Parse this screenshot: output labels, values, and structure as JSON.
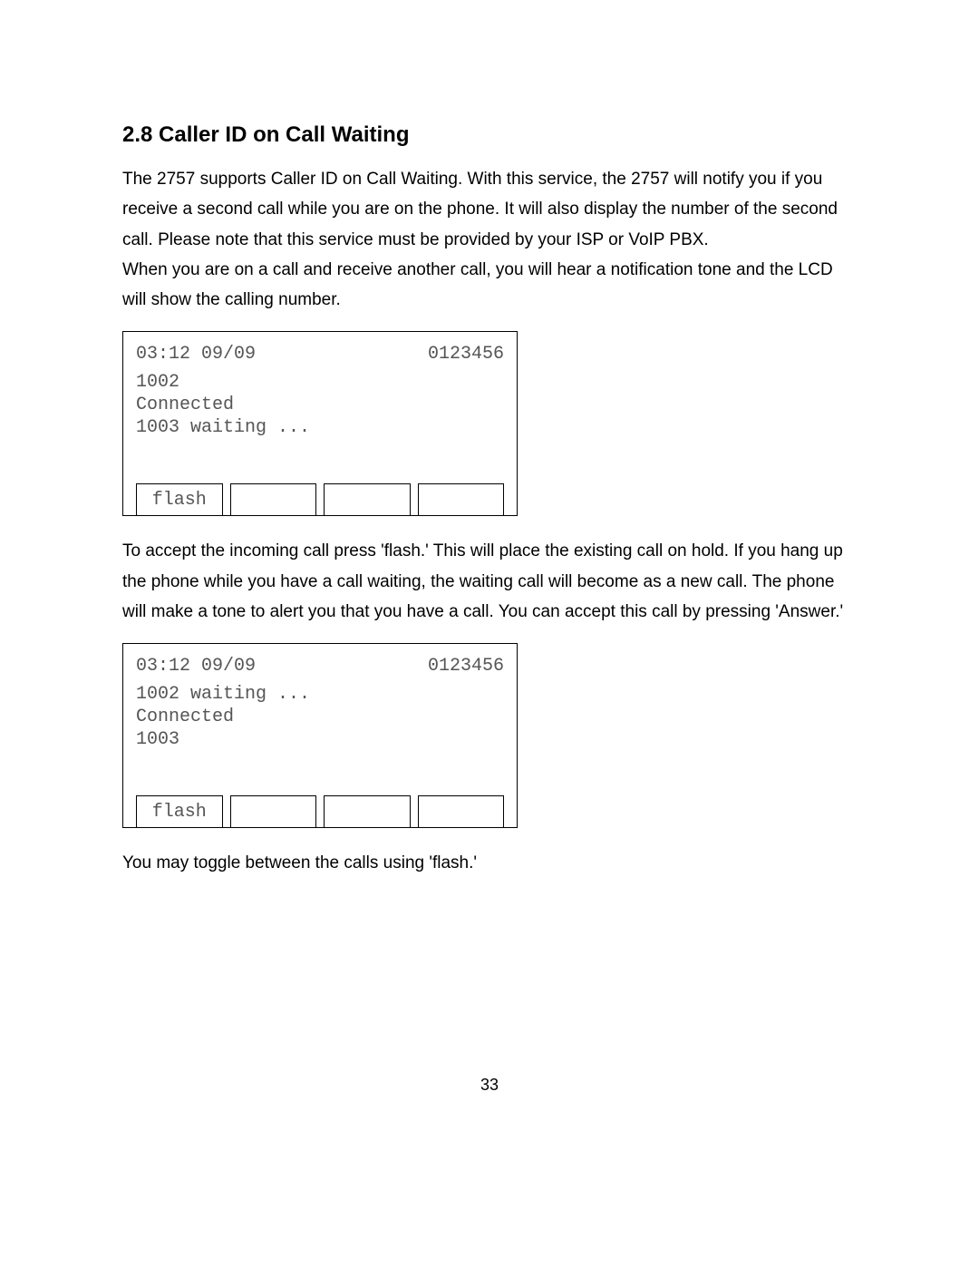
{
  "heading": "2.8 Caller ID on Call Waiting",
  "para1": "The 2757 supports Caller ID on Call Waiting.   With this service, the 2757 will notify you if you receive a second call while you are on the phone.   It will also display the number of the second call.   Please note that this service must be provided by your ISP or VoIP PBX.",
  "para2": "When you are on a call and receive another call, you will hear a notification tone and the LCD will show the calling number.",
  "lcd1": {
    "time_date": "03:12 09/09",
    "right": "0123456",
    "line1": "1002",
    "line2": "Connected",
    "line3": "1003 waiting ...",
    "sk1": "flash",
    "sk2": "",
    "sk3": "",
    "sk4": ""
  },
  "para3": "To accept the incoming call press 'flash.'   This will place the existing call on hold.   If you hang up the phone while you have a call waiting, the waiting call will become as a new call.   The phone will make a tone to alert you that you have a call.   You can accept this call by pressing 'Answer.'",
  "lcd2": {
    "time_date": "03:12 09/09",
    "right": "0123456",
    "line1": "1002 waiting ...",
    "line2": "Connected",
    "line3": "1003",
    "sk1": "flash",
    "sk2": "",
    "sk3": "",
    "sk4": ""
  },
  "para4": "You may toggle between the calls using 'flash.'",
  "page_number": "33"
}
